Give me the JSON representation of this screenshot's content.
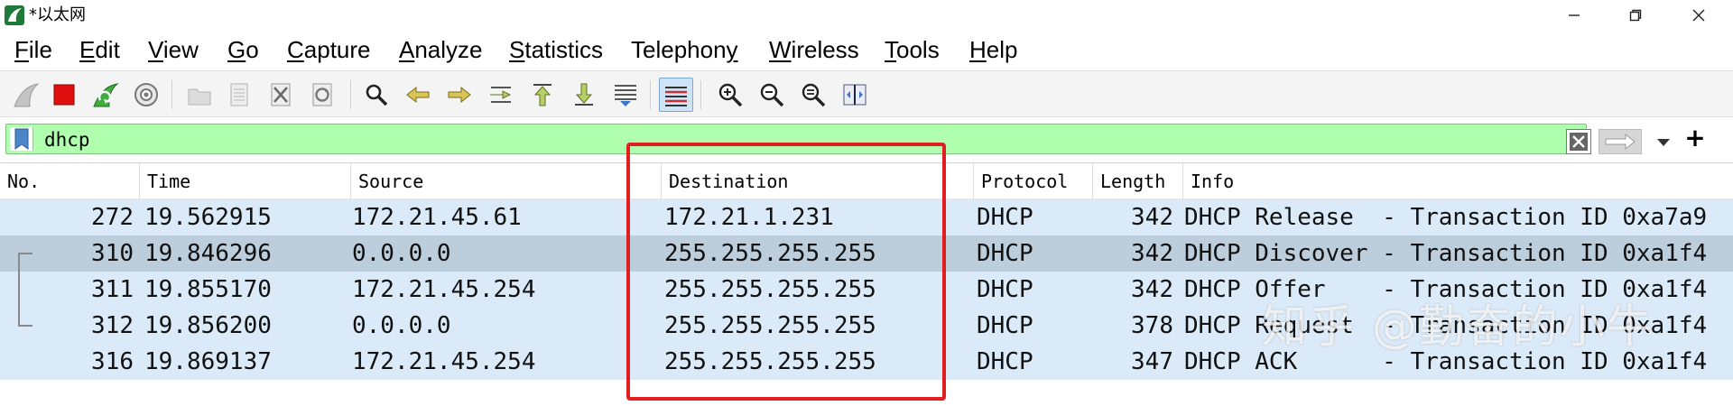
{
  "window": {
    "title": "*以太网"
  },
  "menu": {
    "items": [
      {
        "u": "F",
        "rest": "ile"
      },
      {
        "u": "E",
        "rest": "dit"
      },
      {
        "u": "V",
        "rest": "iew"
      },
      {
        "u": "G",
        "rest": "o"
      },
      {
        "u": "C",
        "rest": "apture"
      },
      {
        "u": "A",
        "rest": "nalyze"
      },
      {
        "u": "S",
        "rest": "tatistics"
      },
      {
        "pre": "Telephon",
        "u": "y",
        "rest": ""
      },
      {
        "u": "W",
        "rest": "ireless"
      },
      {
        "u": "T",
        "rest": "ools"
      },
      {
        "u": "H",
        "rest": "elp"
      }
    ]
  },
  "toolbar": {
    "icons": [
      "shark-fin-start-icon",
      "stop-capture-icon",
      "restart-capture-icon",
      "capture-options-gear-icon",
      "open-file-icon",
      "save-file-icon",
      "close-file-icon",
      "reload-file-icon",
      "find-packet-icon",
      "go-back-icon",
      "go-forward-icon",
      "go-to-packet-icon",
      "go-first-packet-icon",
      "go-last-packet-icon",
      "auto-scroll-icon",
      "colorize-icon",
      "zoom-in-icon",
      "zoom-out-icon",
      "zoom-normal-icon",
      "resize-columns-icon"
    ]
  },
  "filter": {
    "value": "dhcp",
    "add_label": "+"
  },
  "packet_list": {
    "columns": [
      "No.",
      "Time",
      "Source",
      "Destination",
      "Protocol",
      "Length",
      "Info"
    ],
    "rows": [
      {
        "no": "272",
        "time": "19.562915",
        "source": "172.21.45.61",
        "destination": "172.21.1.231",
        "protocol": "DHCP",
        "length": "342",
        "info": "DHCP Release  - Transaction ID 0xa7a9"
      },
      {
        "no": "310",
        "time": "19.846296",
        "source": "0.0.0.0",
        "destination": "255.255.255.255",
        "protocol": "DHCP",
        "length": "342",
        "info": "DHCP Discover - Transaction ID 0xa1f4"
      },
      {
        "no": "311",
        "time": "19.855170",
        "source": "172.21.45.254",
        "destination": "255.255.255.255",
        "protocol": "DHCP",
        "length": "342",
        "info": "DHCP Offer    - Transaction ID 0xa1f4"
      },
      {
        "no": "312",
        "time": "19.856200",
        "source": "0.0.0.0",
        "destination": "255.255.255.255",
        "protocol": "DHCP",
        "length": "378",
        "info": "DHCP Request  - Transaction ID 0xa1f4"
      },
      {
        "no": "316",
        "time": "19.869137",
        "source": "172.21.45.254",
        "destination": "255.255.255.255",
        "protocol": "DHCP",
        "length": "347",
        "info": "DHCP ACK      - Transaction ID 0xa1f4"
      }
    ],
    "selected_row": 1
  },
  "watermark": "知乎 @勤奋的小牛",
  "colors": {
    "filter_valid_bg": "#afffaf",
    "row_bg": "#dbeaf8",
    "row_selected_bg": "#bccddc",
    "annotation_red": "#e02020"
  }
}
